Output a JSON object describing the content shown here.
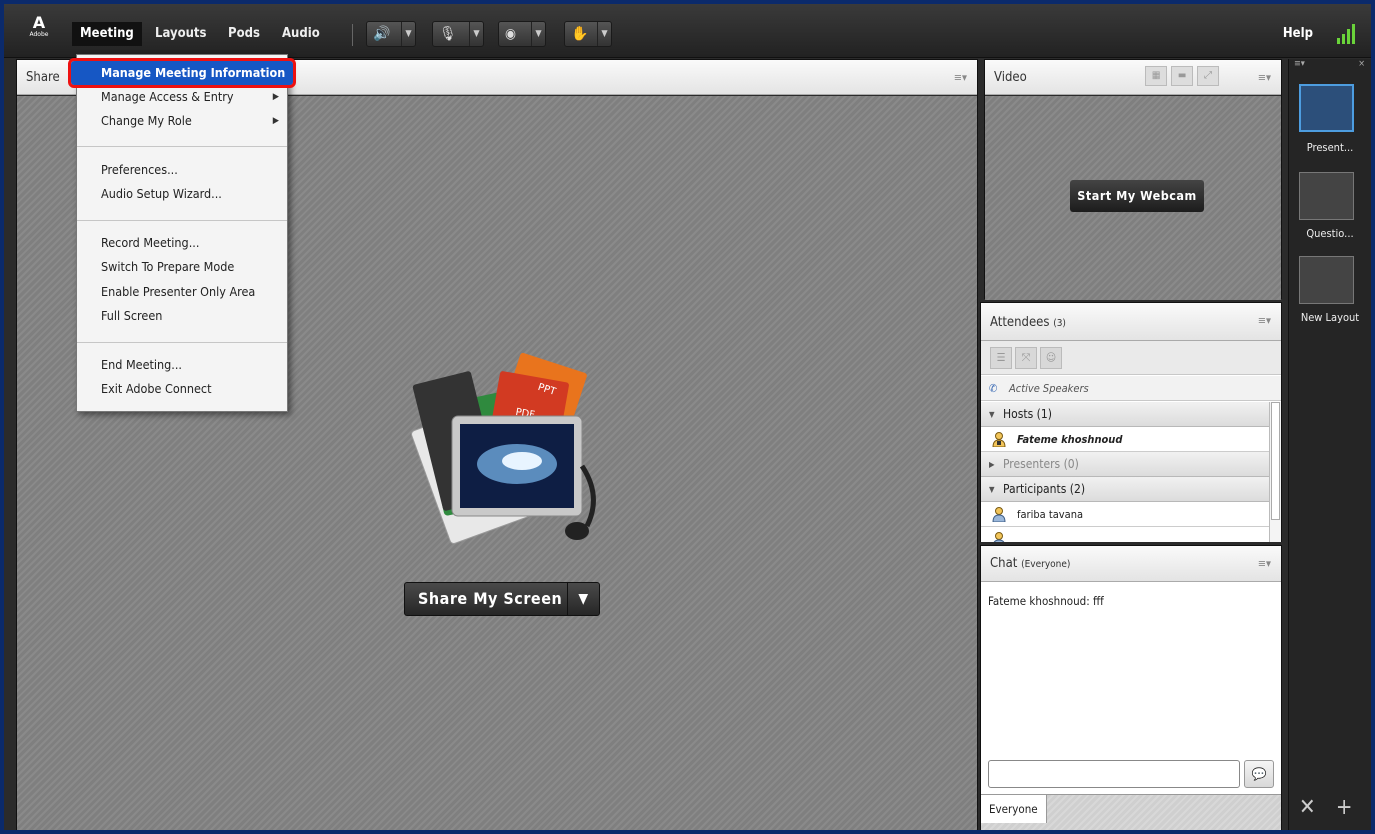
{
  "app": {
    "logo_text": "A",
    "logo_sub": "Adobe",
    "menus": [
      "Meeting",
      "Layouts",
      "Pods",
      "Audio"
    ],
    "help_label": "Help",
    "colors": {
      "accent": "#1657c4",
      "highlight_outline": "#e11111",
      "speaker_green": "#7dd83b",
      "signal_green": "#6ad33a"
    }
  },
  "toolbar": {
    "buttons": [
      {
        "icon": "speaker-icon",
        "glyph": "🔊"
      },
      {
        "icon": "microphone-icon",
        "glyph": "🎙"
      },
      {
        "icon": "webcam-icon",
        "glyph": "◉"
      },
      {
        "icon": "raise-hand-icon",
        "glyph": "✋"
      }
    ]
  },
  "meeting_menu": {
    "items": [
      {
        "label": "Manage Meeting Information",
        "highlighted": true
      },
      {
        "label": "Manage Access & Entry",
        "submenu": true
      },
      {
        "label": "Change My Role",
        "submenu": true
      },
      {
        "label": "Preferences..."
      },
      {
        "label": "Audio Setup Wizard..."
      },
      {
        "label": "Record Meeting..."
      },
      {
        "label": "Switch To Prepare Mode"
      },
      {
        "label": "Enable Presenter Only Area"
      },
      {
        "label": "Full Screen"
      },
      {
        "label": "End Meeting..."
      },
      {
        "label": "Exit Adobe Connect"
      }
    ]
  },
  "share_pod": {
    "title": "Share",
    "share_button": "Share My Screen",
    "art_labels": [
      "PPT",
      "PDF"
    ]
  },
  "video_pod": {
    "title": "Video",
    "webcam_button": "Start My Webcam"
  },
  "attendees_pod": {
    "title": "Attendees",
    "count": "(3)",
    "active_speakers": "Active Speakers",
    "groups": [
      {
        "label": "Hosts (1)",
        "expanded": true,
        "members": [
          "Fateme khoshnoud"
        ]
      },
      {
        "label": "Presenters (0)",
        "expanded": false,
        "members": []
      },
      {
        "label": "Participants (2)",
        "expanded": true,
        "members": [
          "fariba tavana"
        ]
      }
    ]
  },
  "chat_pod": {
    "title": "Chat",
    "audience": "(Everyone)",
    "messages": [
      {
        "sender": "Fateme khoshnoud",
        "text": "fff"
      }
    ],
    "message_line": "Fateme khoshnoud: fff",
    "input_value": "",
    "tab_label": "Everyone"
  },
  "layouts_bar": {
    "items": [
      {
        "label": "Present...",
        "selected": true
      },
      {
        "label": "Questio...",
        "selected": false
      },
      {
        "label": "New Layout",
        "selected": false
      }
    ]
  }
}
